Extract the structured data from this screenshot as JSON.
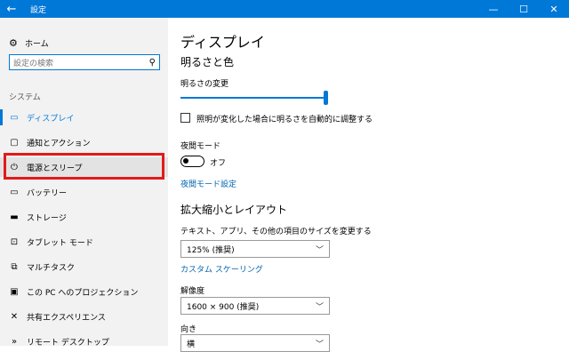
{
  "window": {
    "title": "設定",
    "back_glyph": "←",
    "minimize_glyph": "—",
    "maximize_glyph": "☐",
    "close_glyph": "✕"
  },
  "sidebar": {
    "home_label": "ホーム",
    "search_placeholder": "設定の検索",
    "section_label": "システム",
    "items": [
      {
        "label": "ディスプレイ",
        "icon": "display-icon"
      },
      {
        "label": "通知とアクション",
        "icon": "notification-icon"
      },
      {
        "label": "電源とスリープ",
        "icon": "power-icon"
      },
      {
        "label": "バッテリー",
        "icon": "battery-icon"
      },
      {
        "label": "ストレージ",
        "icon": "storage-icon"
      },
      {
        "label": "タブレット モード",
        "icon": "tablet-icon"
      },
      {
        "label": "マルチタスク",
        "icon": "multitask-icon"
      },
      {
        "label": "この PC へのプロジェクション",
        "icon": "projection-icon"
      },
      {
        "label": "共有エクスペリエンス",
        "icon": "share-icon"
      },
      {
        "label": "リモート デスクトップ",
        "icon": "remote-desktop-icon"
      }
    ]
  },
  "main": {
    "page_title": "ディスプレイ",
    "brightness_heading": "明るさと色",
    "brightness_label": "明るさの変更",
    "brightness_value": 1.0,
    "auto_brightness_label": "照明が変化した場合に明るさを自動的に調整する",
    "night_mode_label": "夜間モード",
    "night_mode_state": "オフ",
    "night_mode_settings_link": "夜間モード設定",
    "scale_heading": "拡大縮小とレイアウト",
    "scale_label": "テキスト、アプリ、その他の項目のサイズを変更する",
    "scale_value": "125% (推奨)",
    "custom_scaling_link": "カスタム スケーリング",
    "resolution_label": "解像度",
    "resolution_value": "1600 × 900 (推奨)",
    "orientation_label": "向き",
    "orientation_value": "横"
  },
  "colors": {
    "accent": "#0078d7",
    "highlight_border": "#e01b1b"
  }
}
